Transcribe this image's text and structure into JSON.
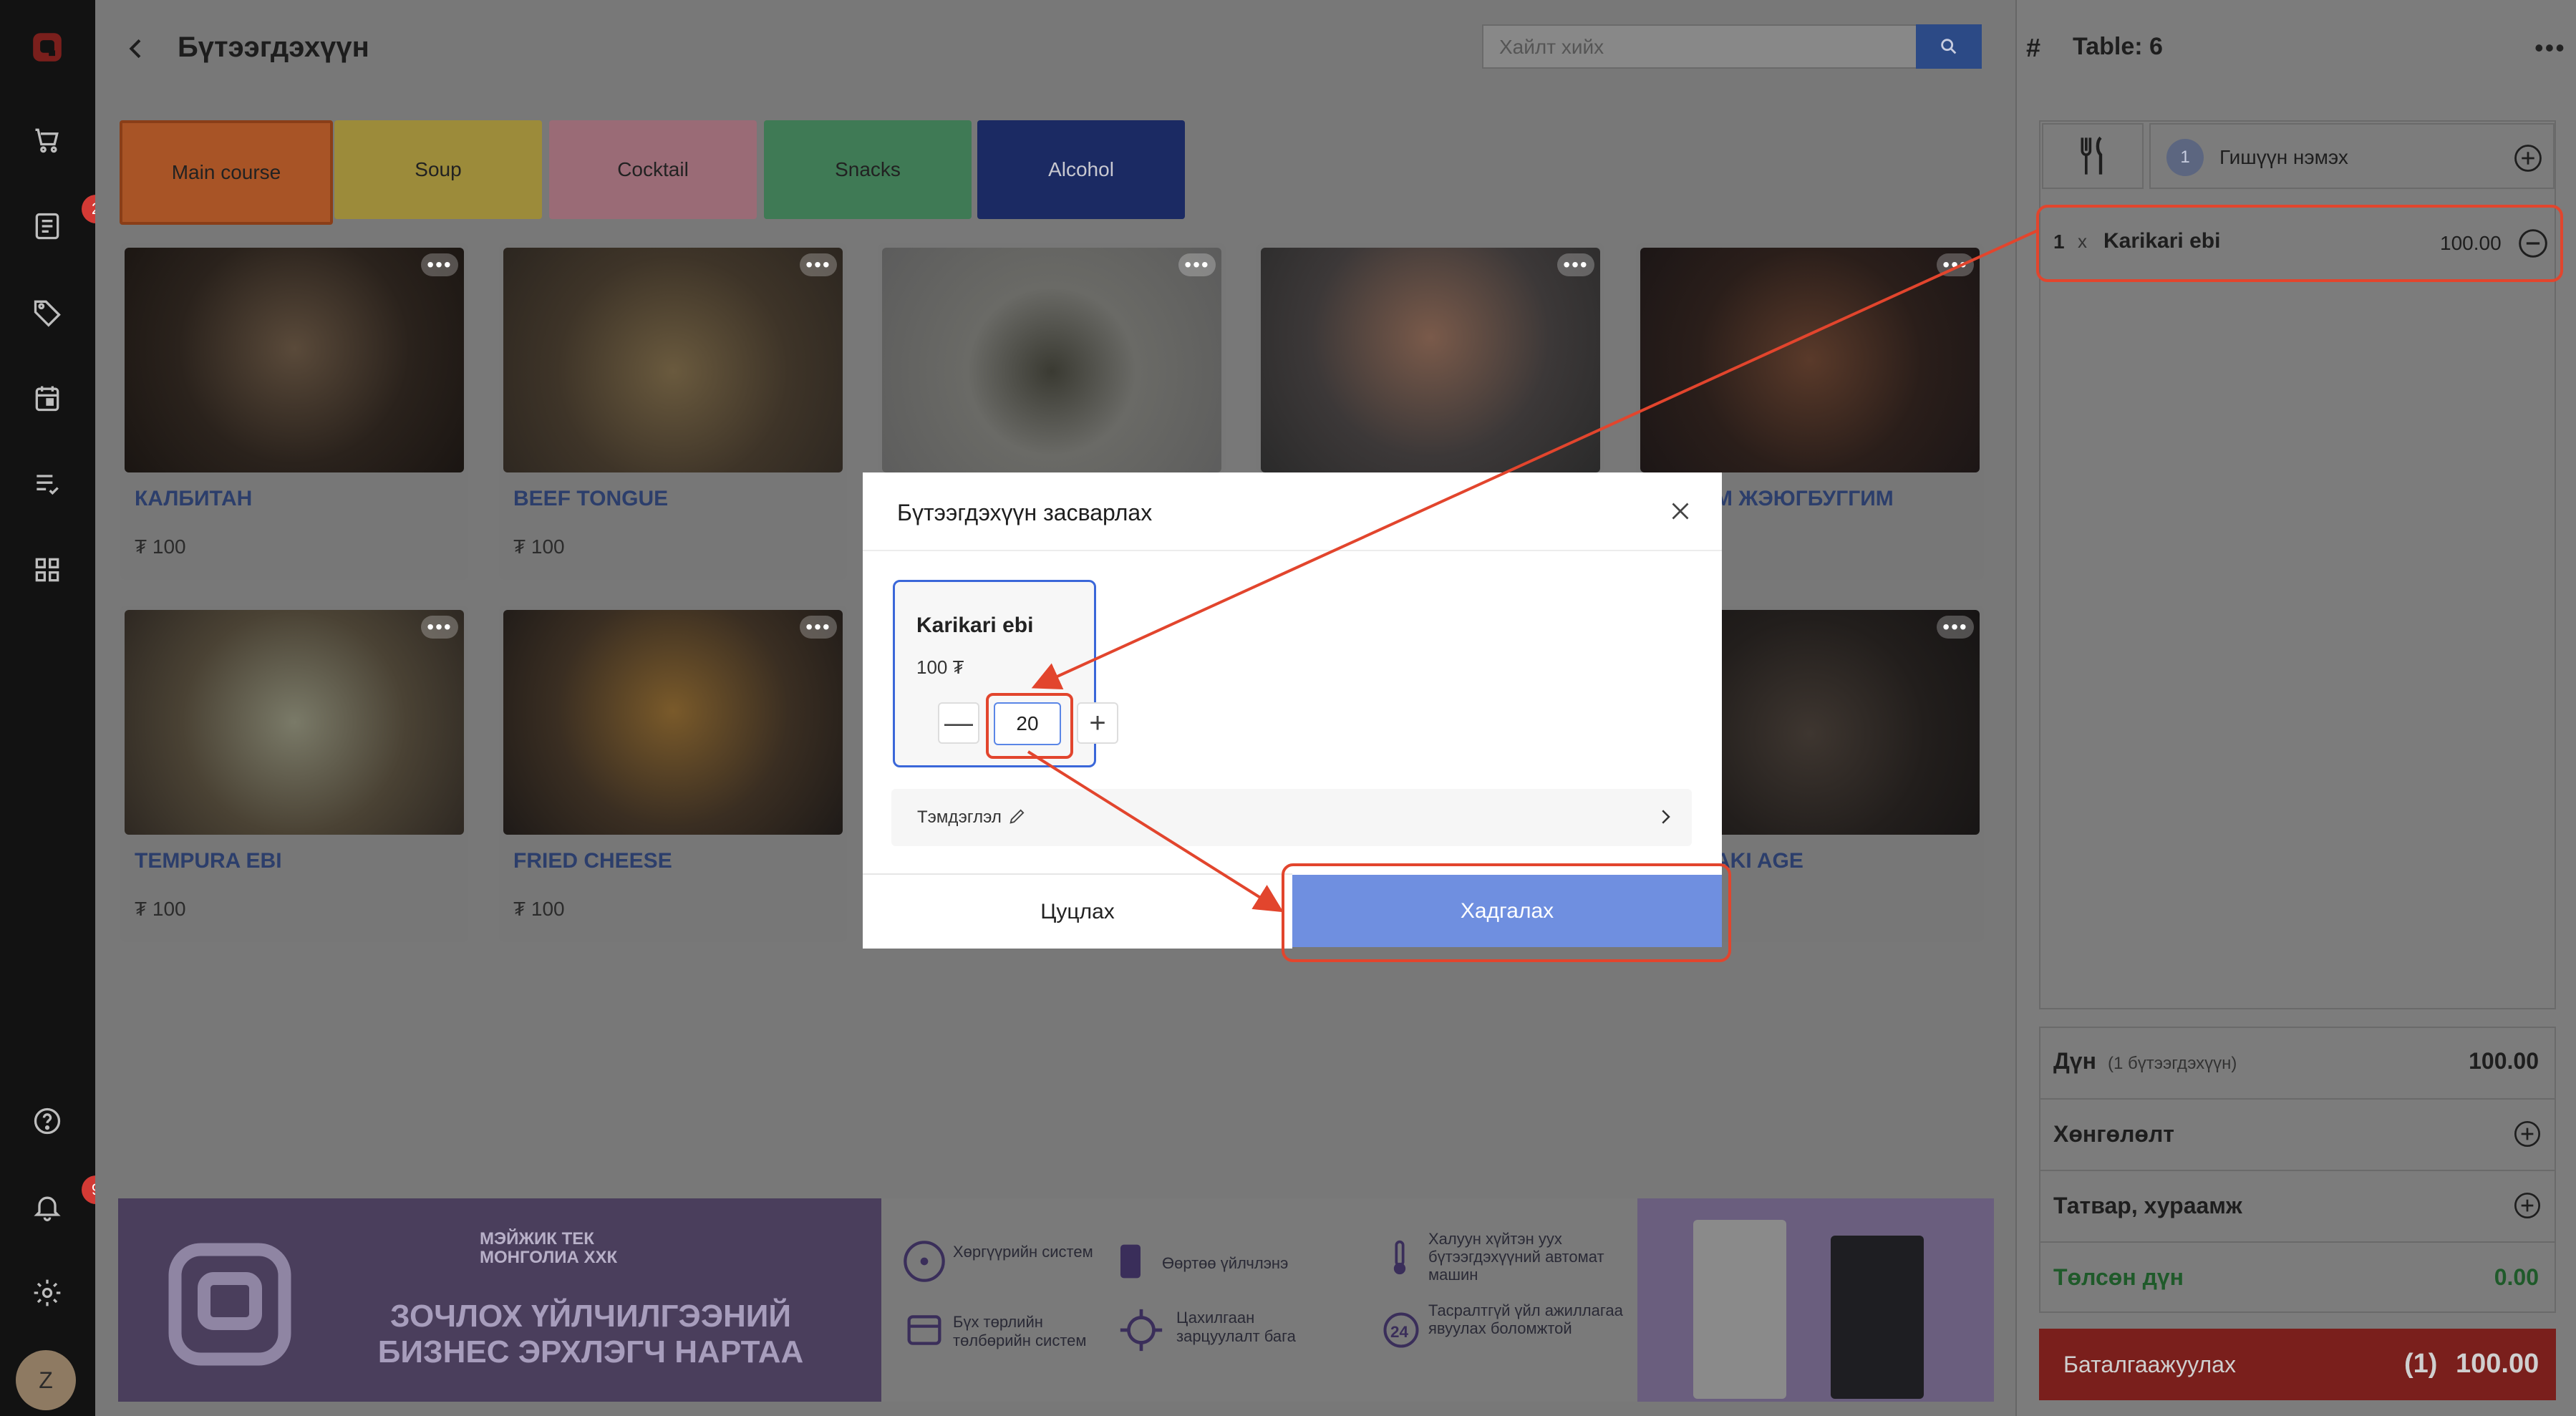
{
  "sidebar": {
    "orders_badge": "2",
    "notifications_badge": "9",
    "user_initial": "Z"
  },
  "header": {
    "title": "Бүтээгдэхүүн",
    "search_placeholder": "Хайлт хийх"
  },
  "categories": [
    {
      "label": "Main course",
      "color": "#a85426"
    },
    {
      "label": "Soup",
      "color": "#9c8b3a"
    },
    {
      "label": "Cocktail",
      "color": "#9a6b76"
    },
    {
      "label": "Snacks",
      "color": "#3f7a55"
    },
    {
      "label": "Alcohol",
      "color": "#1b2a63"
    }
  ],
  "products": [
    {
      "name": "КАЛБИТАН",
      "price": "₮ 100"
    },
    {
      "name": "BEEF TONGUE",
      "price": "₮ 100"
    },
    {
      "name": "",
      "price": ""
    },
    {
      "name": "",
      "price": ""
    },
    {
      "name": "М ЖЭЮГБУГГИМ",
      "price": ""
    },
    {
      "name": "TEMPURA EBI",
      "price": "₮ 100"
    },
    {
      "name": "FRIED CHEESE",
      "price": "₮ 100"
    },
    {
      "name": "АKI AGE",
      "price": ""
    }
  ],
  "banner": {
    "brand": "МЭЙЖИК ТЕК МОНГОЛИА ХХК",
    "headline_1": "ЗОЧЛОХ ҮЙЛЧИЛГЭЭНИЙ",
    "headline_2": "БИЗНЕС ЭРХЛЭГЧ НАРТАА",
    "features": [
      "Хөргүүрийн систем",
      "Өөртөө үйлчлэнэ",
      "Халуун хүйтэн уух бүтээгдэхүүний автомат машин",
      "Бүх төрлийн төлбөрийн систем",
      "Цахилгаан зарцуулалт бага",
      "Тасралтгүй үйл ажиллагаа явуулах боломжтой"
    ]
  },
  "order": {
    "table_label": "Table: 6",
    "guest_count": "1",
    "add_guest_label": "Гишүүн нэмэх",
    "item": {
      "qty": "1",
      "x": "x",
      "name": "Karikari ebi",
      "price": "100.00"
    },
    "summary": [
      {
        "label": "Дүн",
        "sub": "(1 бүтээгдэхүүн)",
        "value": "100.00"
      },
      {
        "label": "Хөнгөлөлт",
        "sub": "",
        "value": ""
      },
      {
        "label": "Татвар, хураамж",
        "sub": "",
        "value": ""
      },
      {
        "label": "Төлсөн дүн",
        "sub": "",
        "value": "0.00"
      }
    ],
    "confirm_label": "Баталгаажуулах",
    "confirm_count": "(1)",
    "confirm_total": "100.00"
  },
  "modal": {
    "title": "Бүтээгдэхүүн засварлах",
    "product_name": "Karikari ebi",
    "product_price": "100 ₮",
    "quantity": "20",
    "note_label": "Тэмдэглэл",
    "cancel_label": "Цуцлах",
    "save_label": "Хадгалах"
  },
  "colors": {
    "accent": "#6f8fe0",
    "highlight": "#e2452d",
    "confirm": "#c0352f"
  }
}
